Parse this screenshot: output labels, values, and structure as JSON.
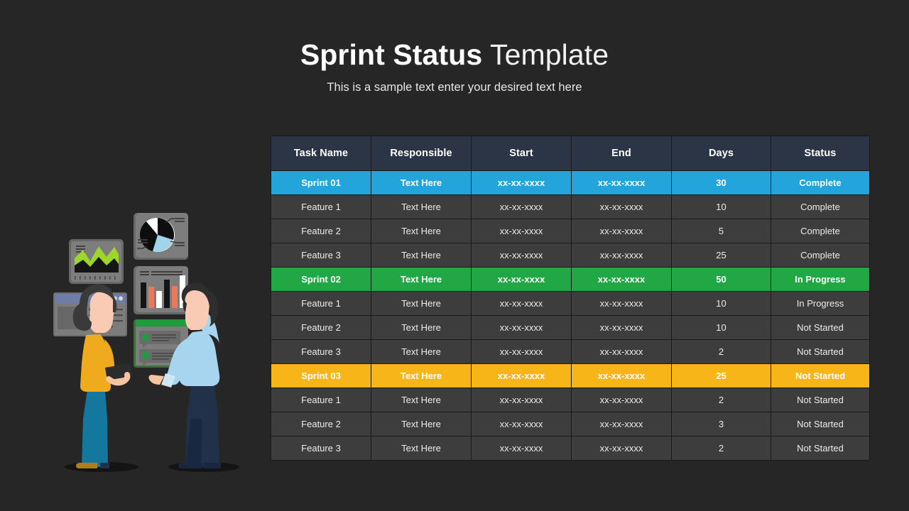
{
  "background_color": "#262626",
  "header": {
    "title_bold": "Sprint Status",
    "title_light": " Template",
    "subtitle": "This is a sample text enter your desired text here"
  },
  "table": {
    "columns": [
      "Task Name",
      "Responsible",
      "Start",
      "End",
      "Days",
      "Status"
    ],
    "header_bg": "#2c3545",
    "row_bg": "#3d3d3d",
    "border_color": "#1a1a1a",
    "accent_blue": "#23a4db",
    "accent_green": "#22a745",
    "accent_yellow": "#f8b518",
    "rows": [
      {
        "type": "sprint",
        "accent": "blue",
        "cells": [
          "Sprint 01",
          "Text Here",
          "xx-xx-xxxx",
          "xx-xx-xxxx",
          "30",
          "Complete"
        ]
      },
      {
        "type": "task",
        "accent": "none",
        "cells": [
          "Feature 1",
          "Text Here",
          "xx-xx-xxxx",
          "xx-xx-xxxx",
          "10",
          "Complete"
        ]
      },
      {
        "type": "task",
        "accent": "none",
        "cells": [
          "Feature 2",
          "Text Here",
          "xx-xx-xxxx",
          "xx-xx-xxxx",
          "5",
          "Complete"
        ]
      },
      {
        "type": "task",
        "accent": "none",
        "cells": [
          "Feature 3",
          "Text Here",
          "xx-xx-xxxx",
          "xx-xx-xxxx",
          "25",
          "Complete"
        ]
      },
      {
        "type": "sprint",
        "accent": "green",
        "cells": [
          "Sprint 02",
          "Text Here",
          "xx-xx-xxxx",
          "xx-xx-xxxx",
          "50",
          "In Progress"
        ]
      },
      {
        "type": "task",
        "accent": "none",
        "cells": [
          "Feature 1",
          "Text Here",
          "xx-xx-xxxx",
          "xx-xx-xxxx",
          "10",
          "In Progress"
        ]
      },
      {
        "type": "task",
        "accent": "none",
        "cells": [
          "Feature 2",
          "Text Here",
          "xx-xx-xxxx",
          "xx-xx-xxxx",
          "10",
          "Not Started"
        ]
      },
      {
        "type": "task",
        "accent": "none",
        "cells": [
          "Feature 3",
          "Text Here",
          "xx-xx-xxxx",
          "xx-xx-xxxx",
          "2",
          "Not Started"
        ]
      },
      {
        "type": "sprint",
        "accent": "yellow",
        "cells": [
          "Sprint 03",
          "Text Here",
          "xx-xx-xxxx",
          "xx-xx-xxxx",
          "25",
          "Not Started"
        ]
      },
      {
        "type": "task",
        "accent": "none",
        "cells": [
          "Feature 1",
          "Text Here",
          "xx-xx-xxxx",
          "xx-xx-xxxx",
          "2",
          "Not Started"
        ]
      },
      {
        "type": "task",
        "accent": "none",
        "cells": [
          "Feature 2",
          "Text Here",
          "xx-xx-xxxx",
          "xx-xx-xxxx",
          "3",
          "Not Started"
        ]
      },
      {
        "type": "task",
        "accent": "none",
        "cells": [
          "Feature 3",
          "Text Here",
          "xx-xx-xxxx",
          "xx-xx-xxxx",
          "2",
          "Not Started"
        ]
      }
    ]
  },
  "illustration": {
    "name": "team-analytics-dashboard-illustration",
    "panels": [
      {
        "name": "area-chart-panel",
        "icon": "area-chart-icon"
      },
      {
        "name": "browser-window-panel",
        "icon": "browser-window-icon"
      },
      {
        "name": "pie-chart-panel",
        "icon": "pie-chart-icon"
      },
      {
        "name": "bar-chart-panel",
        "icon": "bar-chart-icon"
      },
      {
        "name": "message-list-panel",
        "icon": "chat-list-icon"
      }
    ],
    "figures": [
      {
        "name": "woman-with-tablet",
        "shirt_color": "#f0aa1e",
        "pants_color": "#14789e",
        "shoe_color": "#b07d16"
      },
      {
        "name": "man-pointing",
        "shirt_color": "#a7d4ef",
        "pants_color": "#21314a"
      }
    ]
  }
}
